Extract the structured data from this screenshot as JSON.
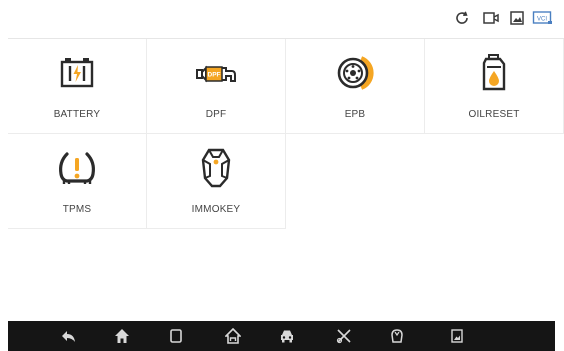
{
  "topbar": {
    "icons": [
      "refresh-icon",
      "video-record-icon",
      "screenshot-icon",
      "vci-status-icon"
    ],
    "vci_label": "VCI"
  },
  "functions": [
    {
      "label": "BATTERY",
      "icon": "battery-icon"
    },
    {
      "label": "DPF",
      "icon": "dpf-icon",
      "icon_text": "DPF"
    },
    {
      "label": "EPB",
      "icon": "epb-brake-icon"
    },
    {
      "label": "OILRESET",
      "icon": "oil-can-icon"
    },
    {
      "label": "TPMS",
      "icon": "tpms-icon"
    },
    {
      "label": "IMMOKEY",
      "icon": "immo-key-icon"
    }
  ],
  "navbar": {
    "icons": [
      "back-icon",
      "home-icon",
      "recent-apps-icon",
      "vehicle-home-icon",
      "car-icon",
      "tools-icon",
      "fingerprint-icon",
      "gallery-icon"
    ]
  },
  "colors": {
    "accent": "#f5a623",
    "icon_dark": "#2b2b2b",
    "navbar_bg": "#151515",
    "topbar_icon": "#3a3a3a",
    "vci_blue": "#4a7fc1"
  }
}
